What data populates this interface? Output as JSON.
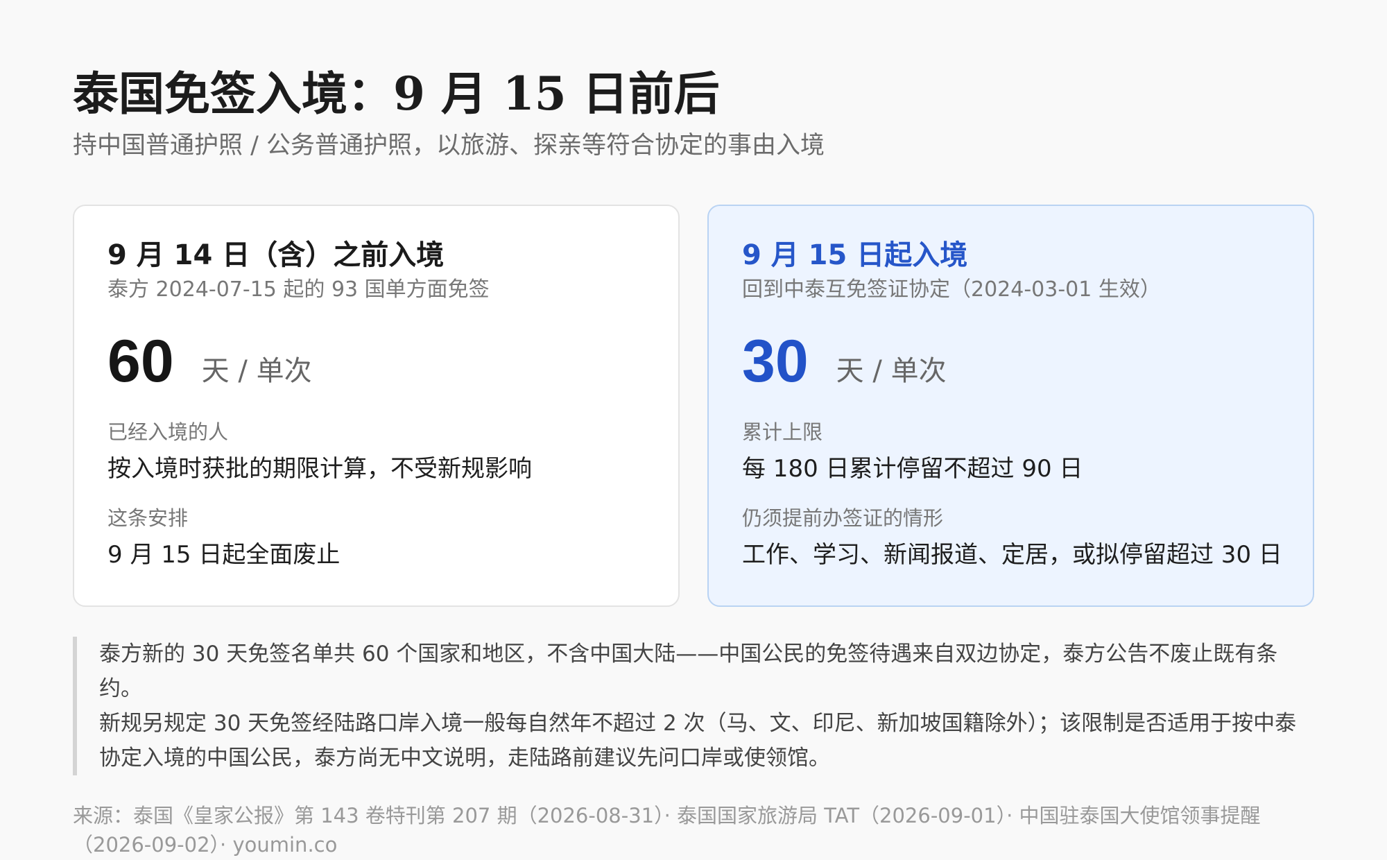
{
  "header": {
    "title": "泰国免签入境：9 月 15 日前后",
    "subtitle": "持中国普通护照 / 公务普通护照，以旅游、探亲等符合协定的事由入境"
  },
  "left_card": {
    "title": "9 月 14 日（含）之前入境",
    "subtitle": "泰方 2024-07-15 起的 93 国单方面免签",
    "big_number": "60",
    "unit": "天 / 单次",
    "label1": "已经入境的人",
    "value1": "按入境时获批的期限计算，不受新规影响",
    "label2": "这条安排",
    "value2": "9 月 15 日起全面废止"
  },
  "right_card": {
    "title": "9 月 15 日起入境",
    "subtitle": "回到中泰互免签证协定（2024-03-01 生效）",
    "big_number": "30",
    "unit": "天 / 单次",
    "label1": "累计上限",
    "value1": "每 180 日累计停留不超过 90 日",
    "label2": "仍须提前办签证的情形",
    "value2": "工作、学习、新闻报道、定居，或拟停留超过 30 日"
  },
  "note": {
    "paragraph1": "泰方新的 30 天免签名单共 60 个国家和地区，不含中国大陆——中国公民的免签待遇来自双边协定，泰方公告不废止既有条约。",
    "paragraph2": "新规另规定 30 天免签经陆路口岸入境一般每自然年不超过 2 次（马、文、印尼、新加坡国籍除外）；该限制是否适用于按中泰协定入境的中国公民，泰方尚无中文说明，走陆路前建议先问口岸或使领馆。"
  },
  "source": "来源：泰国《皇家公报》第 143 卷特刊第 207 期（2026-08-31）· 泰国国家旅游局 TAT（2026-09-01）· 中国驻泰国大使馆领事提醒（2026-09-02）· youmin.co",
  "colors": {
    "accent_blue": "#2656c9",
    "right_card_bg": "#edf4ff",
    "right_card_border": "#b9d3f3"
  }
}
